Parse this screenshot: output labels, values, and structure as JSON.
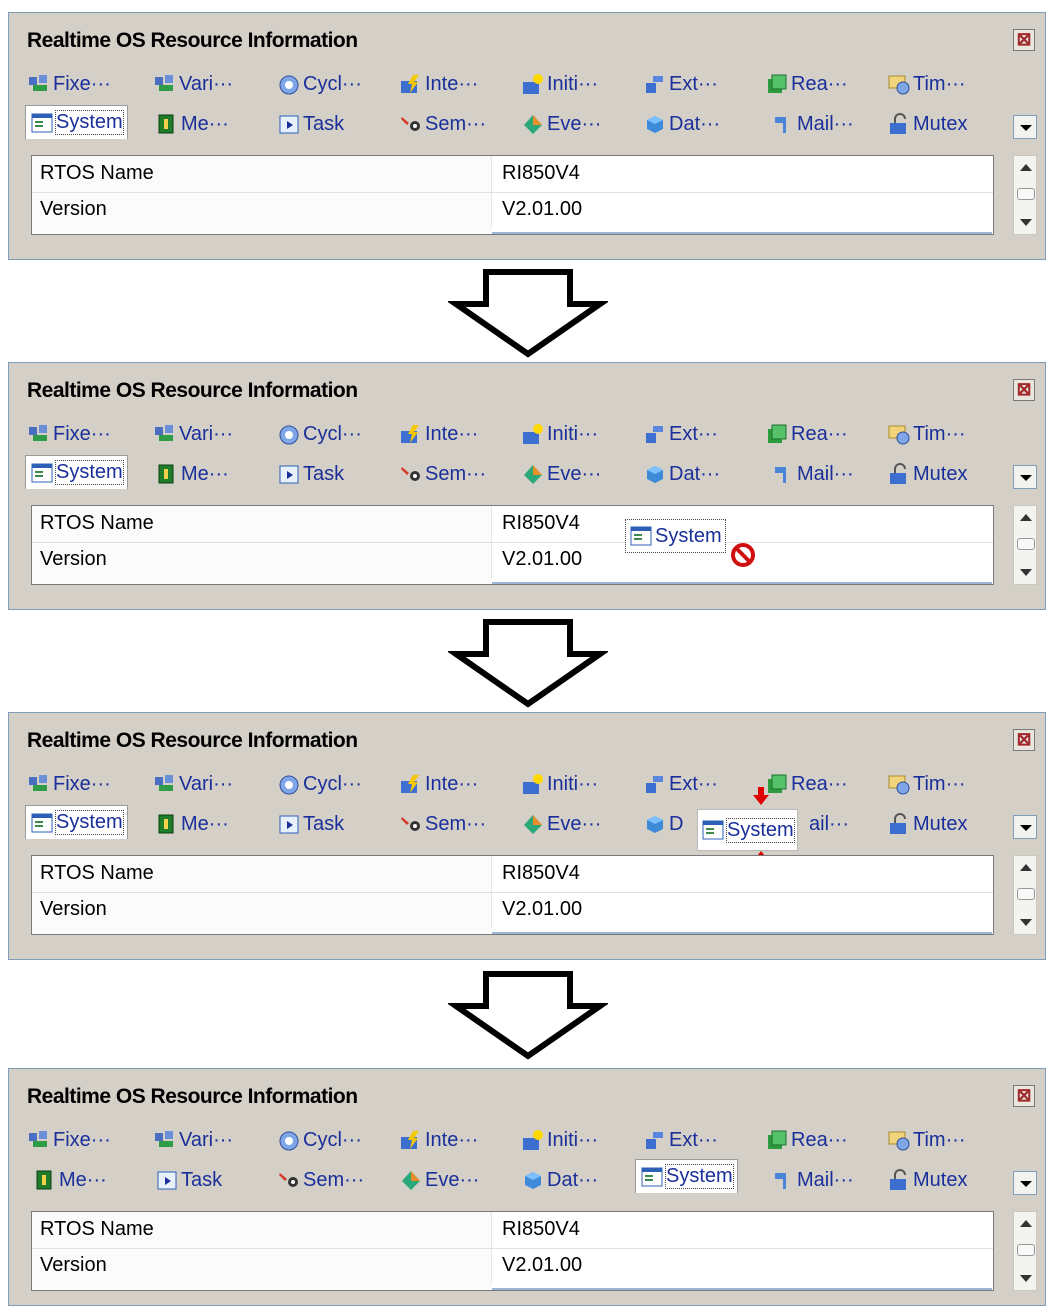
{
  "window": {
    "title": "Realtime OS Resource Information",
    "close_label": "⊠"
  },
  "tabs": {
    "fixed": "Fixe···",
    "variable": "Vari···",
    "cyclic": "Cycl···",
    "interrupt": "Inte···",
    "initial": "Initi···",
    "extended": "Ext···",
    "ready": "Rea···",
    "timer": "Tim···",
    "system": "System",
    "memory": "Me···",
    "task": "Task",
    "semaphore": "Sem···",
    "event": "Eve···",
    "data": "Dat···",
    "data_partial": "D",
    "mail": "Mail···",
    "mail_partial": "ail···",
    "mutex": "Mutex"
  },
  "grid": {
    "rows": [
      {
        "key": "RTOS Name",
        "value": "RI850V4"
      },
      {
        "key": "Version",
        "value": "V2.01.00"
      }
    ]
  },
  "icons": {
    "fixed": "fixed-pool-icon",
    "variable": "variable-pool-icon",
    "cyclic": "cyclic-handler-icon",
    "interrupt": "interrupt-icon",
    "initial": "initialize-icon",
    "extended": "extended-icon",
    "ready": "ready-queue-icon",
    "timer": "timer-icon",
    "system": "system-icon",
    "memory": "memory-icon",
    "task": "task-icon",
    "semaphore": "semaphore-icon",
    "event": "event-flag-icon",
    "data": "data-queue-icon",
    "mail": "mailbox-icon",
    "mutex": "mutex-icon"
  },
  "colors": {
    "panel_bg": "#d4d0c8",
    "tab_text": "#1a2f9a",
    "border": "#7f9db9",
    "drop_arrow": "#e00000"
  }
}
